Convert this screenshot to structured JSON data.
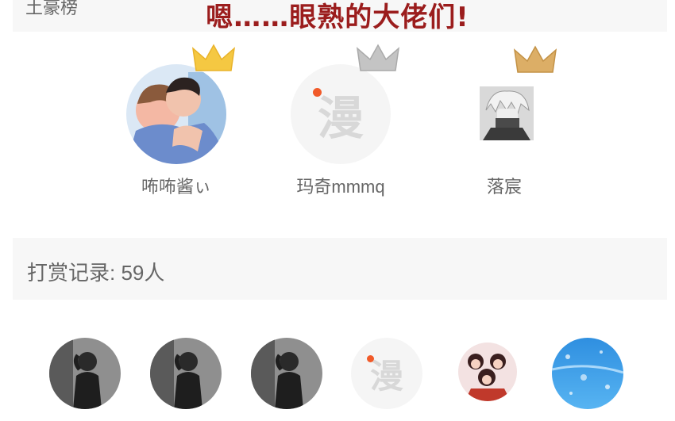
{
  "header": {
    "section_label": "土豪榜",
    "banner_text": "嗯……眼熟的大佬们!"
  },
  "ranking": [
    {
      "name": "咘咘酱ぃ",
      "crown": "gold-crown-icon",
      "crown_color": "#f5c842"
    },
    {
      "name": "玛奇mmmq",
      "crown": "silver-crown-icon",
      "crown_color": "#b3b3b3"
    },
    {
      "name": "落宸",
      "crown": "bronze-crown-icon",
      "crown_color": "#d9a85f"
    }
  ],
  "tip_record": {
    "label": "打赏记录: 59人"
  },
  "logo_glyph": "漫",
  "colors": {
    "banner": "#9b1d1d",
    "logo_dot": "#f15a29",
    "section_bg": "#f7f7f7"
  }
}
